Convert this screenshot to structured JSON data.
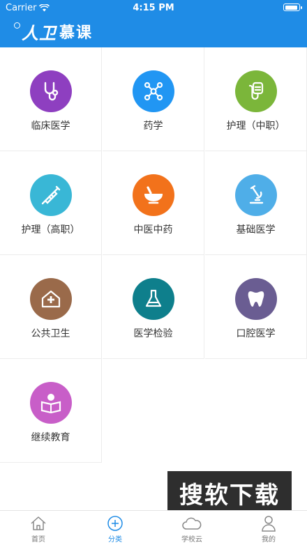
{
  "status_bar": {
    "carrier": "Carrier",
    "time": "4:15 PM"
  },
  "app": {
    "logo_mark": "人卫",
    "logo_word": "慕课"
  },
  "categories": [
    {
      "label": "临床医学",
      "icon": "stethoscope-icon",
      "color": "#8e3fc0"
    },
    {
      "label": "药学",
      "icon": "molecule-icon",
      "color": "#2196f3"
    },
    {
      "label": "护理（中职）",
      "icon": "iv-bag-icon",
      "color": "#7bb63a"
    },
    {
      "label": "护理（高职）",
      "icon": "syringe-icon",
      "color": "#39b7d6"
    },
    {
      "label": "中医中药",
      "icon": "mortar-pestle-icon",
      "color": "#f2721b"
    },
    {
      "label": "基础医学",
      "icon": "microscope-icon",
      "color": "#4faee8"
    },
    {
      "label": "公共卫生",
      "icon": "public-health-house-icon",
      "color": "#9a6a4a"
    },
    {
      "label": "医学检验",
      "icon": "flask-icon",
      "color": "#0e7f8c"
    },
    {
      "label": "口腔医学",
      "icon": "tooth-icon",
      "color": "#6a5d92"
    },
    {
      "label": "继续教育",
      "icon": "reader-book-icon",
      "color": "#c85ec8"
    }
  ],
  "watermark": "搜软下载",
  "tabs": [
    {
      "label": "首页",
      "icon": "home-icon",
      "active": false
    },
    {
      "label": "分类",
      "icon": "plus-circle-icon",
      "active": true
    },
    {
      "label": "学校云",
      "icon": "cloud-icon",
      "active": false
    },
    {
      "label": "我的",
      "icon": "person-icon",
      "active": false
    }
  ],
  "colors": {
    "brand": "#1f8ce6",
    "tab_inactive": "#777777",
    "divider": "#ececec"
  }
}
